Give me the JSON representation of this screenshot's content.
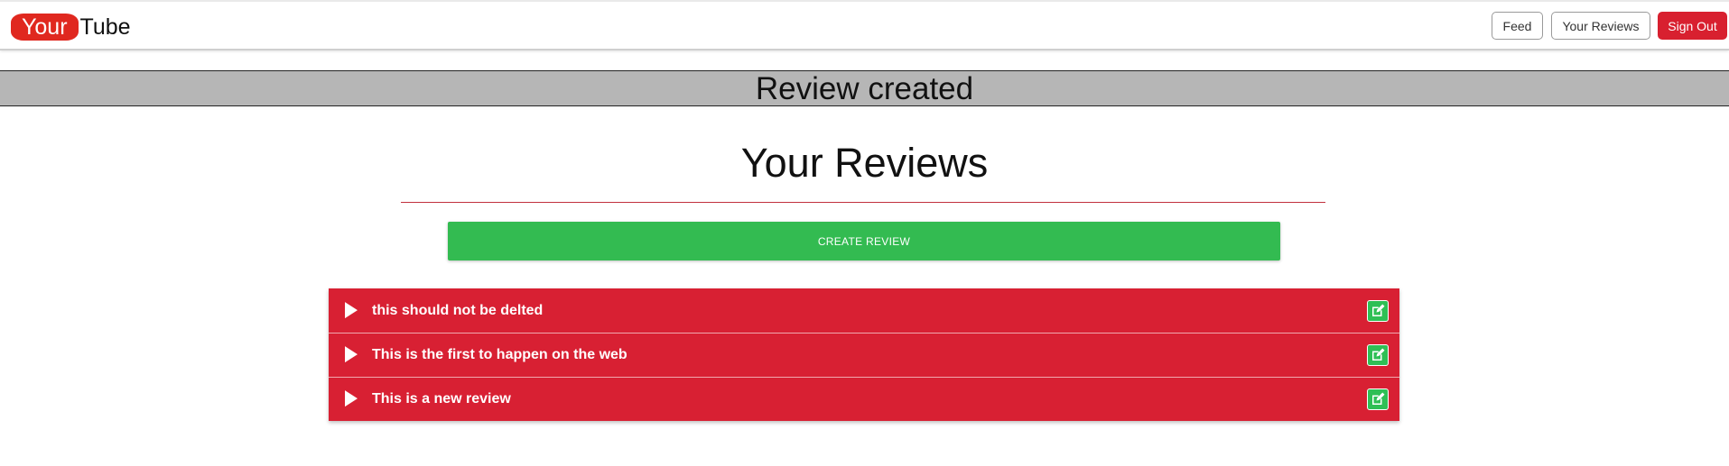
{
  "brand": {
    "part1": "Your",
    "part2": "Tube"
  },
  "nav": {
    "feed": "Feed",
    "your_reviews": "Your Reviews",
    "sign_out": "Sign Out"
  },
  "alert": {
    "message": "Review created"
  },
  "main": {
    "title": "Your Reviews",
    "create_button": "CREATE REVIEW",
    "reviews": [
      {
        "title": "this should not be delted"
      },
      {
        "title": "This is the first to happen on the web"
      },
      {
        "title": "This is a new review"
      }
    ]
  },
  "colors": {
    "brand_red": "#e0281f",
    "review_red": "#d82033",
    "success_green": "#33bb51",
    "alert_gray": "#b6b6b6"
  },
  "icons": {
    "play": "play-icon",
    "edit": "edit-icon"
  }
}
